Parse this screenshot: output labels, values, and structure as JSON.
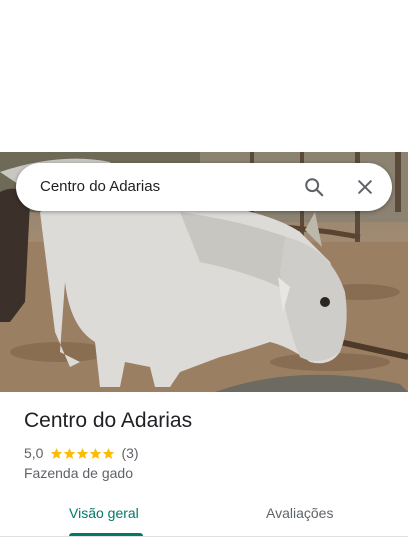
{
  "search": {
    "query": "Centro do Adarias",
    "search_icon": "search-icon",
    "close_icon": "close-icon"
  },
  "photo": {
    "subject": "cattle-photo"
  },
  "place": {
    "name": "Centro do Adarias",
    "rating": "5,0",
    "stars": 5,
    "review_count": "(3)",
    "category": "Fazenda de gado"
  },
  "tabs": [
    {
      "label": "Visão geral",
      "active": true
    },
    {
      "label": "Avaliações",
      "active": false
    }
  ],
  "colors": {
    "accent": "#00796b",
    "star": "#fbbc04",
    "text_primary": "#202124",
    "text_secondary": "#5f6368"
  }
}
